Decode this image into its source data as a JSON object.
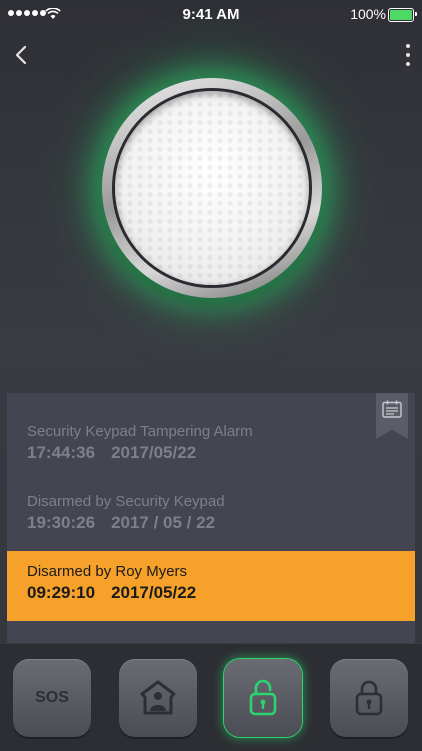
{
  "status_bar": {
    "time": "9:41 AM",
    "battery": "100%",
    "battery_level": 1.0,
    "battery_color": "#4cd964"
  },
  "nav": {
    "back_icon": "chevron-left-icon",
    "menu_icon": "vertical-ellipsis-icon"
  },
  "dial": {
    "glow_color": "#28dc6e",
    "state": "unlocked"
  },
  "log": {
    "calendar_icon": "calendar-icon",
    "entries": [
      {
        "title": "Security Keypad Tampering Alarm",
        "time": "17:44:36",
        "date": "2017/05/22"
      },
      {
        "title": "Disarmed by Security Keypad",
        "time": "19:30:26",
        "date": "2017 / 05 / 22"
      },
      {
        "title": "Disarmed by Roy Myers",
        "time": "09:29:10",
        "date": "2017/05/22"
      }
    ],
    "highlight_color": "#f6a12a"
  },
  "controls": {
    "sos_label": "SOS",
    "buttons": [
      "sos",
      "home",
      "disarm",
      "arm"
    ],
    "active_button": "disarm",
    "active_color": "#2bd46f"
  }
}
